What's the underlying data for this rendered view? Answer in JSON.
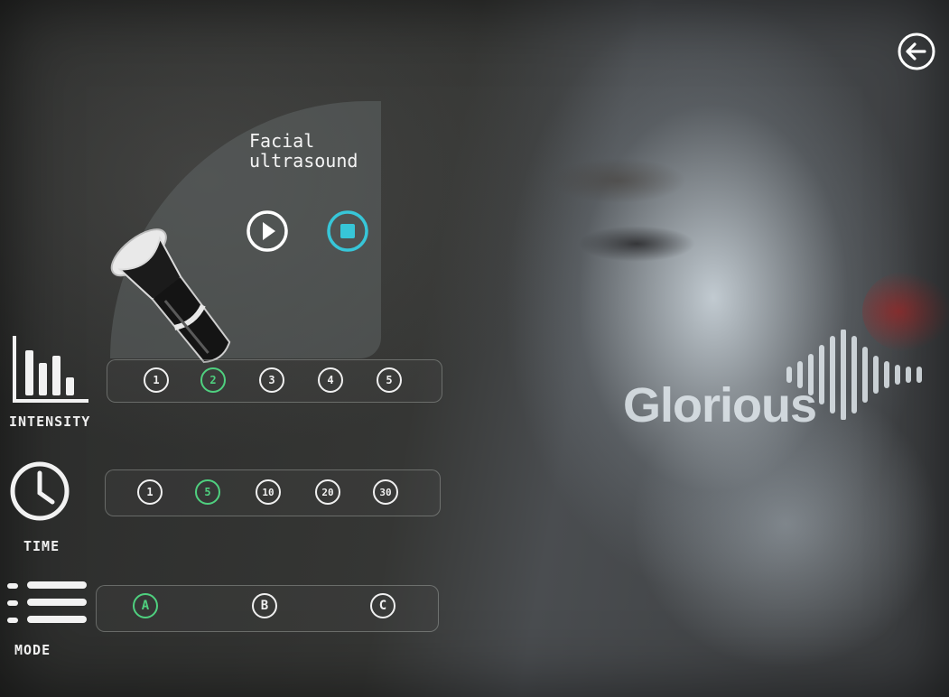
{
  "screen": {
    "title": "Facial\nultrasound",
    "brand": "Glorious"
  },
  "controls": {
    "back_icon": "arrow-left-circle-icon",
    "play_icon": "play-icon",
    "stop_icon": "stop-icon",
    "accent_color": "#4fd07f",
    "stop_color": "#37c6d8"
  },
  "intensity": {
    "label": "INTENSITY",
    "icon": "bar-chart-icon",
    "options": [
      "1",
      "2",
      "3",
      "4",
      "5"
    ],
    "selected": "2"
  },
  "time": {
    "label": "TIME",
    "icon": "clock-icon",
    "options": [
      "1",
      "5",
      "10",
      "20",
      "30"
    ],
    "selected": "5"
  },
  "mode": {
    "label": "MODE",
    "icon": "menu-list-icon",
    "options": [
      "A",
      "B",
      "C"
    ],
    "selected": "A"
  }
}
